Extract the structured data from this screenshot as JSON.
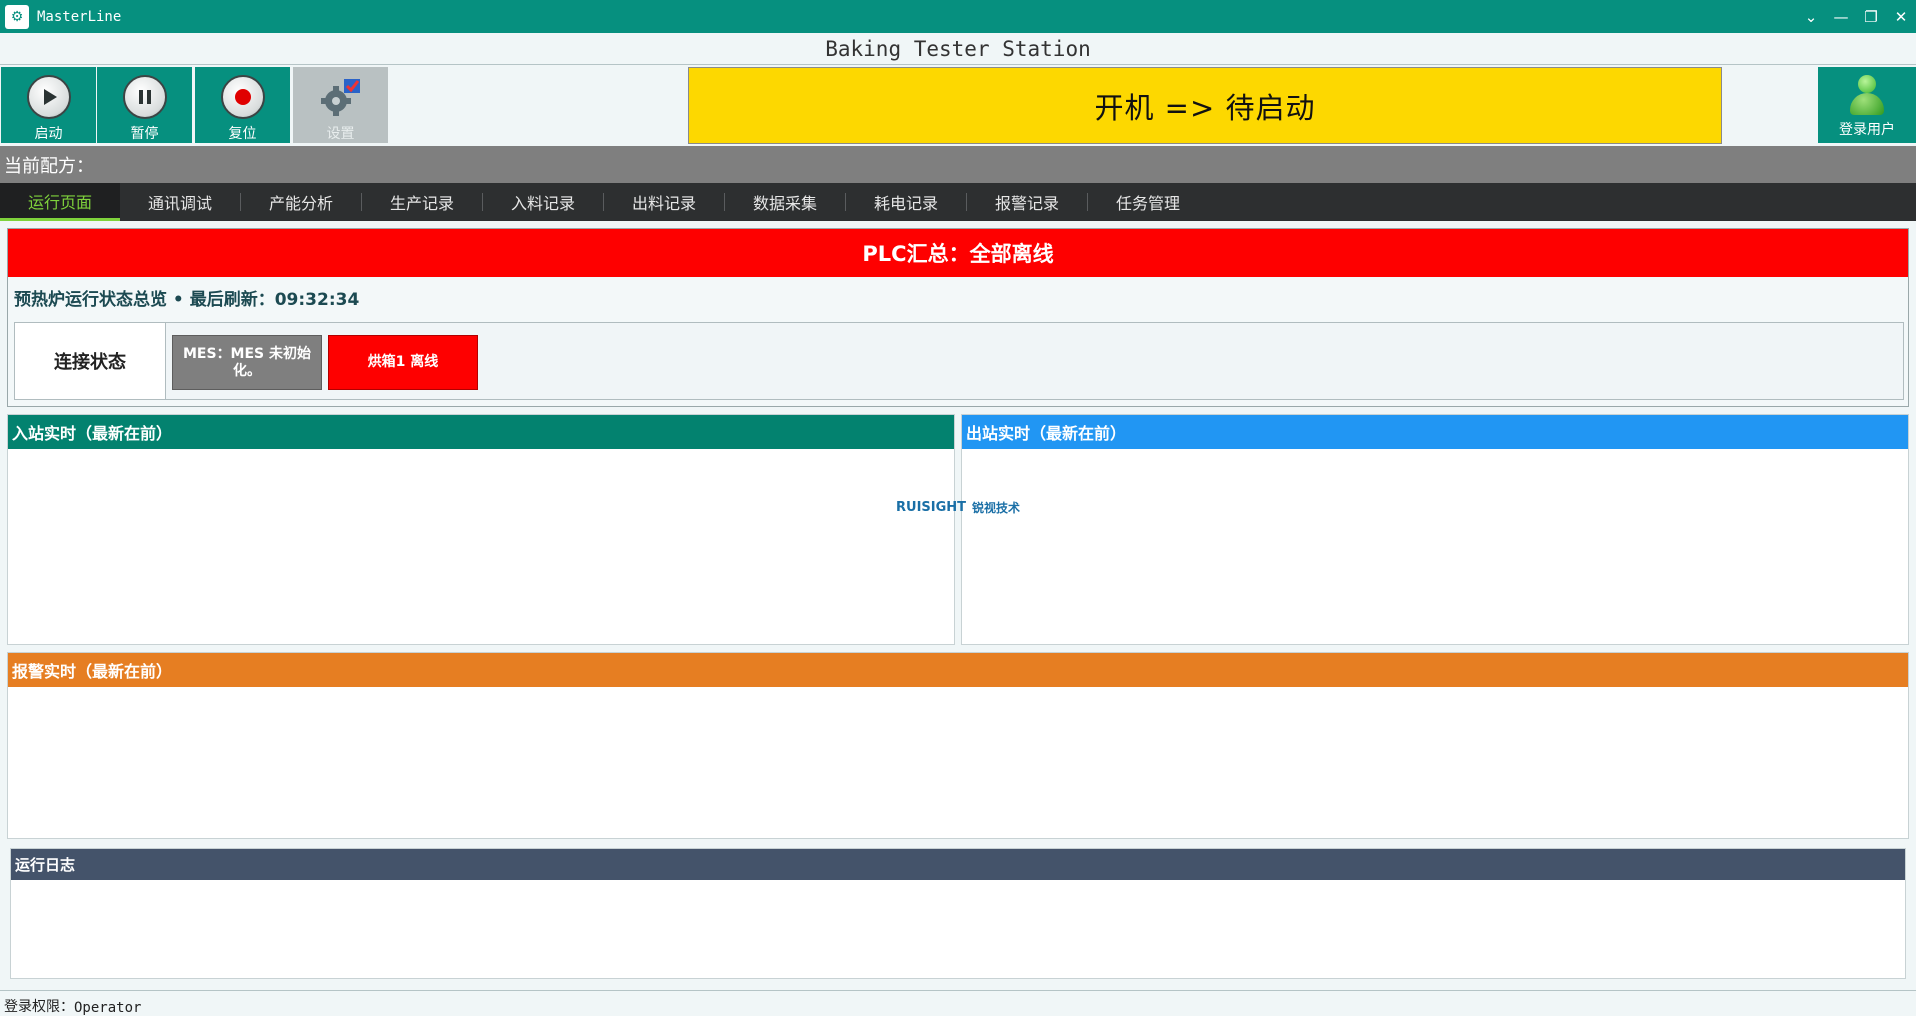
{
  "window": {
    "app_name": "MasterLine",
    "app_icon": "masterline-logo-icon",
    "controls": [
      "chevron-down-icon",
      "minimize-icon",
      "restore-icon",
      "close-icon"
    ]
  },
  "station": {
    "title": "Baking Tester Station"
  },
  "toolbar": {
    "start_label": "启动",
    "pause_label": "暂停",
    "reset_label": "复位",
    "settings_label": "设置",
    "login_label": "登录用户",
    "state_text": "开机 => 待启动"
  },
  "recipe": {
    "label": "当前配方："
  },
  "tabs": [
    {
      "label": "运行页面",
      "active": true
    },
    {
      "label": "通讯调试"
    },
    {
      "label": "产能分析"
    },
    {
      "label": "生产记录"
    },
    {
      "label": "入料记录"
    },
    {
      "label": "出料记录"
    },
    {
      "label": "数据采集"
    },
    {
      "label": "耗电记录"
    },
    {
      "label": "报警记录"
    },
    {
      "label": "任务管理"
    }
  ],
  "plc": {
    "summary": "PLC汇总：全部离线",
    "overview": "预热炉运行状态总览 • 最后刷新：09:32:34",
    "connection_label": "连接状态",
    "chips": [
      {
        "text": "MES：MES 未初始化。",
        "status": "gray"
      },
      {
        "text": "烘箱1 离线",
        "status": "red"
      }
    ]
  },
  "panels": {
    "inbound": "入站实时（最新在前）",
    "outbound": "出站实时（最新在前）",
    "alarm": "报警实时（最新在前）",
    "log": "运行日志"
  },
  "watermark": {
    "brand": "RUISIGHT",
    "cn": "锐视技术"
  },
  "status": {
    "label": "登录权限：",
    "value": "Operator"
  },
  "colors": {
    "titlebar": "#06907f",
    "state_banner": "#fdd800",
    "plc_banner": "#fe0000",
    "inbound_head": "#03826f",
    "outbound_head": "#2196f3",
    "alarm_head": "#e67e22",
    "log_head": "#44536a",
    "active_tab": "#7fd23c"
  }
}
